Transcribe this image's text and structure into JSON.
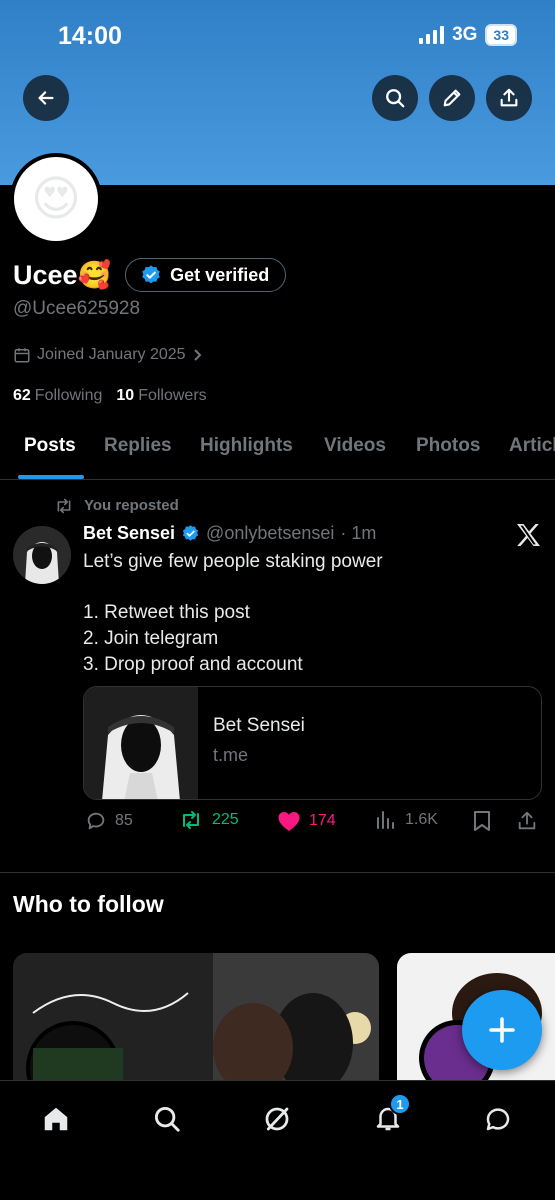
{
  "status_bar": {
    "time": "14:00",
    "network": "3G",
    "battery": "33"
  },
  "profile": {
    "name": "Ucee🥰",
    "handle": "@Ucee625928",
    "verify_label": "Get verified",
    "joined": "Joined January 2025",
    "following_count": "62",
    "following_label": "Following",
    "followers_count": "10",
    "followers_label": "Followers"
  },
  "tabs": [
    "Posts",
    "Replies",
    "Highlights",
    "Videos",
    "Photos",
    "Articles"
  ],
  "post": {
    "repost_label": "You reposted",
    "author": "Bet Sensei",
    "handle": "@onlybetsensei",
    "time": "· 1m",
    "lines": [
      "Let’s give few people staking power",
      "",
      "1. Retweet this post",
      "2. Join telegram",
      "3. Drop proof and account"
    ],
    "card_title": "Bet Sensei",
    "card_domain": "t.me",
    "replies": "85",
    "reposts": "225",
    "likes": "174",
    "views": "1.6K"
  },
  "who_to_follow": {
    "title": "Who to follow"
  },
  "notifications_badge": "1",
  "colors": {
    "accent": "#1d9bf0",
    "repost_green": "#00ba7c",
    "like_pink": "#f91880",
    "banner": "#3a8cd4"
  }
}
